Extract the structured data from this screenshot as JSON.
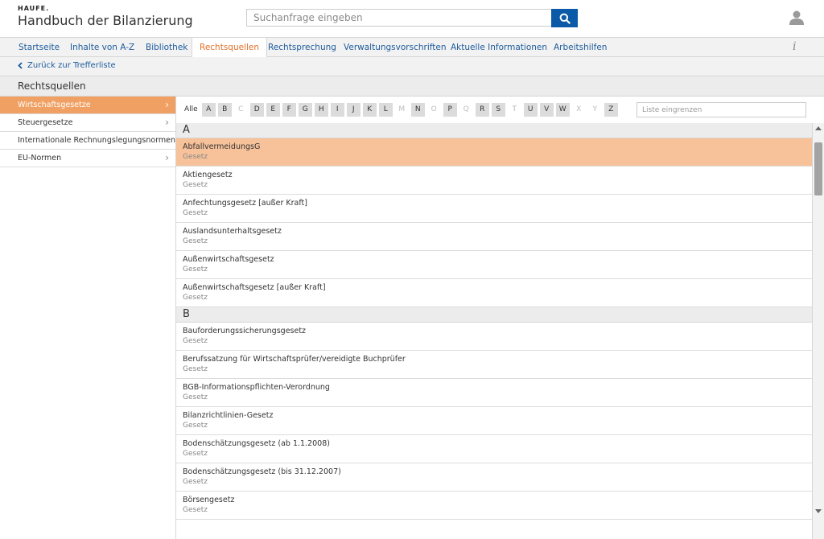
{
  "header": {
    "brand": "HAUFE.",
    "app_title": "Handbuch der Bilanzierung",
    "search_placeholder": "Suchanfrage eingeben",
    "search_icon": "search-icon",
    "user_icon": "user-icon"
  },
  "nav": {
    "items": [
      "Startseite",
      "Inhalte von A-Z",
      "Bibliothek",
      "Rechtsquellen",
      "Rechtsprechung",
      "Verwaltungsvorschriften",
      "Aktuelle Informationen",
      "Arbeitshilfen"
    ],
    "active": "Rechtsquellen",
    "info_label": "i"
  },
  "back": {
    "label": "Zurück zur Trefferliste"
  },
  "section": {
    "title": "Rechtsquellen"
  },
  "sidebar": {
    "items": [
      {
        "label": "Wirtschaftsgesetze"
      },
      {
        "label": "Steuergesetze"
      },
      {
        "label": "Internationale Rechnungslegungsnormen"
      },
      {
        "label": "EU-Normen"
      }
    ],
    "active": "Wirtschaftsgesetze"
  },
  "filter": {
    "all_label": "Alle",
    "letters": [
      {
        "l": "A",
        "enabled": true
      },
      {
        "l": "B",
        "enabled": true
      },
      {
        "l": "C",
        "enabled": false
      },
      {
        "l": "D",
        "enabled": true
      },
      {
        "l": "E",
        "enabled": true
      },
      {
        "l": "F",
        "enabled": true
      },
      {
        "l": "G",
        "enabled": true
      },
      {
        "l": "H",
        "enabled": true
      },
      {
        "l": "I",
        "enabled": true
      },
      {
        "l": "J",
        "enabled": true
      },
      {
        "l": "K",
        "enabled": true
      },
      {
        "l": "L",
        "enabled": true
      },
      {
        "l": "M",
        "enabled": false
      },
      {
        "l": "N",
        "enabled": true
      },
      {
        "l": "O",
        "enabled": false
      },
      {
        "l": "P",
        "enabled": true
      },
      {
        "l": "Q",
        "enabled": false
      },
      {
        "l": "R",
        "enabled": true
      },
      {
        "l": "S",
        "enabled": true
      },
      {
        "l": "T",
        "enabled": false
      },
      {
        "l": "U",
        "enabled": true
      },
      {
        "l": "V",
        "enabled": true
      },
      {
        "l": "W",
        "enabled": true
      },
      {
        "l": "X",
        "enabled": false
      },
      {
        "l": "Y",
        "enabled": false
      },
      {
        "l": "Z",
        "enabled": true
      }
    ],
    "input_placeholder": "Liste eingrenzen"
  },
  "list": {
    "groups": [
      {
        "letter": "A",
        "items": [
          {
            "title": "AbfallvermeidungsG",
            "type": "Gesetz",
            "selected": true
          },
          {
            "title": "Aktiengesetz",
            "type": "Gesetz"
          },
          {
            "title": "Anfechtungsgesetz [außer Kraft]",
            "type": "Gesetz"
          },
          {
            "title": "Auslandsunterhaltsgesetz",
            "type": "Gesetz"
          },
          {
            "title": "Außenwirtschaftsgesetz",
            "type": "Gesetz"
          },
          {
            "title": "Außenwirtschaftsgesetz [außer Kraft]",
            "type": "Gesetz"
          }
        ]
      },
      {
        "letter": "B",
        "items": [
          {
            "title": "Bauforderungssicherungsgesetz",
            "type": "Gesetz"
          },
          {
            "title": "Berufssatzung für Wirtschaftsprüfer/vereidigte Buchprüfer",
            "type": "Gesetz"
          },
          {
            "title": "BGB-Informationspflichten-Verordnung",
            "type": "Gesetz"
          },
          {
            "title": "Bilanzrichtlinien-Gesetz",
            "type": "Gesetz"
          },
          {
            "title": "Bodenschätzungsgesetz (ab 1.1.2008)",
            "type": "Gesetz"
          },
          {
            "title": "Bodenschätzungsgesetz (bis 31.12.2007)",
            "type": "Gesetz"
          },
          {
            "title": "Börsengesetz",
            "type": "Gesetz"
          }
        ]
      }
    ]
  },
  "colors": {
    "accent": "#e2702a",
    "sidebar_active": "#f0a063",
    "row_selected": "#f7c29a",
    "link": "#1d5b9c",
    "search_button": "#0b5aa8"
  }
}
